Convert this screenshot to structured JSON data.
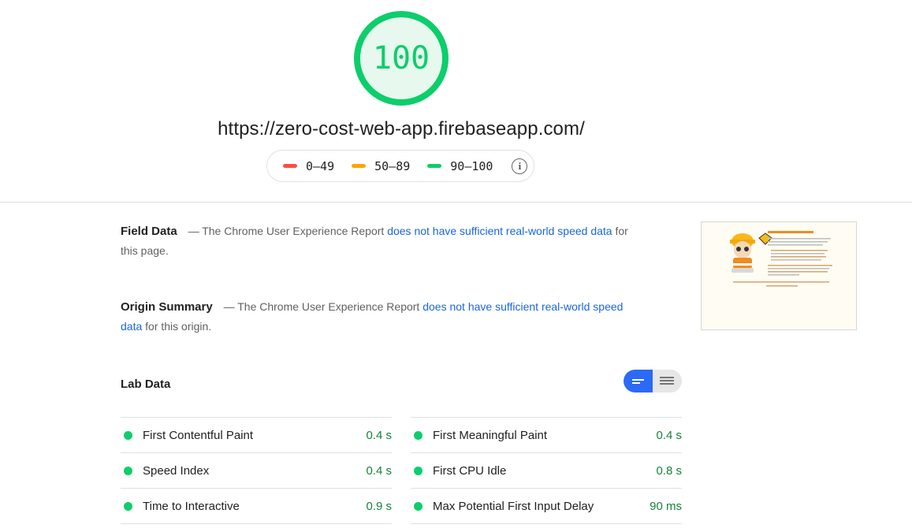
{
  "score": {
    "value": "100",
    "color": "#0cce6b",
    "fill": "#e7f8ee"
  },
  "url": "https://zero-cost-web-app.firebaseapp.com/",
  "legend": {
    "ranges": [
      {
        "label": "0–49",
        "color": "#ff4e42"
      },
      {
        "label": "50–89",
        "color": "#ffa400"
      },
      {
        "label": "90–100",
        "color": "#0cce6b"
      }
    ],
    "info_icon": "info-icon"
  },
  "field_data": {
    "title": "Field Data",
    "prefix": "— The Chrome User Experience Report",
    "link": "does not have sufficient real-world speed data",
    "suffix": "for this page."
  },
  "origin_summary": {
    "title": "Origin Summary",
    "prefix": "— The Chrome User Experience Report",
    "link": "does not have sufficient real-world speed data",
    "suffix": "for this origin."
  },
  "thumbnail": {
    "heading": "Congratulations, you made it!",
    "caption": "This page is hosted with Firebase Hosting"
  },
  "lab_data": {
    "title": "Lab Data",
    "toggle_icons": [
      "summary-view-icon",
      "list-view-icon"
    ],
    "metrics_left": [
      {
        "name": "First Contentful Paint",
        "value": "0.4 s"
      },
      {
        "name": "Speed Index",
        "value": "0.4 s"
      },
      {
        "name": "Time to Interactive",
        "value": "0.9 s"
      }
    ],
    "metrics_right": [
      {
        "name": "First Meaningful Paint",
        "value": "0.4 s"
      },
      {
        "name": "First CPU Idle",
        "value": "0.8 s"
      },
      {
        "name": "Max Potential First Input Delay",
        "value": "90 ms"
      }
    ],
    "pass_color": "#0cce6b",
    "value_color": "#178239"
  }
}
